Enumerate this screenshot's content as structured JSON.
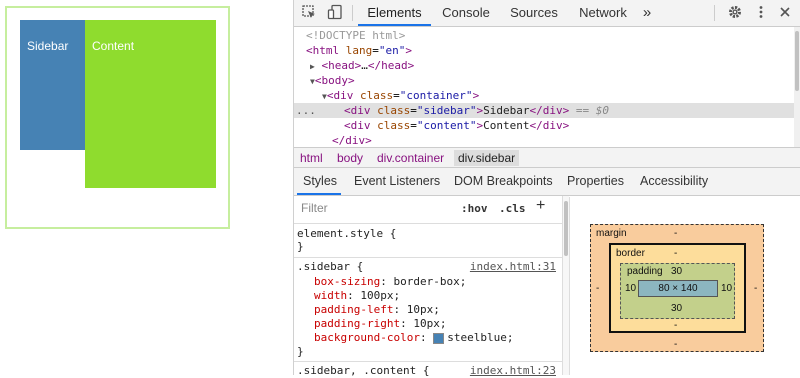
{
  "preview": {
    "sidebar_text": "Sidebar",
    "content_text": "Content",
    "colors": {
      "sidebar": "#4682b4",
      "content": "#8fdc2e",
      "container_border": "#c6ee9e"
    }
  },
  "toolbar": {
    "tabs": [
      "Elements",
      "Console",
      "Sources",
      "Network"
    ],
    "more": "»",
    "icons": [
      "select-element-icon",
      "device-toolbar-icon",
      "settings-icon",
      "more-options-icon",
      "close-icon"
    ]
  },
  "dom_tree": {
    "doctype": "<!DOCTYPE html>",
    "html_open": {
      "tag": "<html",
      "attr": "lang",
      "value": "\"en\"",
      "close": ">"
    },
    "head": {
      "open": "<head>",
      "ellipsis": "…",
      "close": "</head>"
    },
    "body_open": "<body>",
    "container_open": {
      "tag": "<div",
      "attr": "class",
      "value": "\"container\"",
      "close": ">"
    },
    "sidebar": {
      "tag": "<div",
      "attr": "class",
      "value": "\"sidebar\"",
      "close": ">",
      "text": "Sidebar",
      "end": "</div>",
      "marker": "== $0"
    },
    "content": {
      "tag": "<div",
      "attr": "class",
      "value": "\"content\"",
      "close": ">",
      "text": "Content",
      "end": "</div>"
    },
    "container_close": "</div>",
    "dots": "..."
  },
  "breadcrumbs": [
    "html",
    "body",
    "div.container",
    "div.sidebar"
  ],
  "panel_tabs": [
    "Styles",
    "Event Listeners",
    "DOM Breakpoints",
    "Properties",
    "Accessibility"
  ],
  "filter": {
    "placeholder": "Filter",
    "hov": ":hov",
    "cls": ".cls",
    "plus": "+"
  },
  "styles": {
    "element_style": {
      "selector": "element.style {",
      "close": "}"
    },
    "sidebar_rule": {
      "selector": ".sidebar {",
      "source": "index.html:31",
      "declarations": [
        {
          "name": "box-sizing",
          "value": "border-box;"
        },
        {
          "name": "width",
          "value": "100px;"
        },
        {
          "name": "padding-left",
          "value": "10px;"
        },
        {
          "name": "padding-right",
          "value": "10px;"
        },
        {
          "name": "background-color",
          "value": "steelblue;"
        }
      ],
      "close": "}"
    },
    "next_rule": {
      "selector": ".sidebar, .content {",
      "source": "index.html:23"
    }
  },
  "box_model": {
    "margin_label": "margin",
    "margin_top": "-",
    "margin_bottom": "-",
    "margin_left": "-",
    "margin_right": "-",
    "border_label": "border",
    "border_top": "-",
    "border_bottom": "-",
    "padding_label": "padding",
    "padding_top": "30",
    "padding_bottom": "30",
    "padding_left": "10",
    "padding_right": "10",
    "content": "80 × 140"
  }
}
